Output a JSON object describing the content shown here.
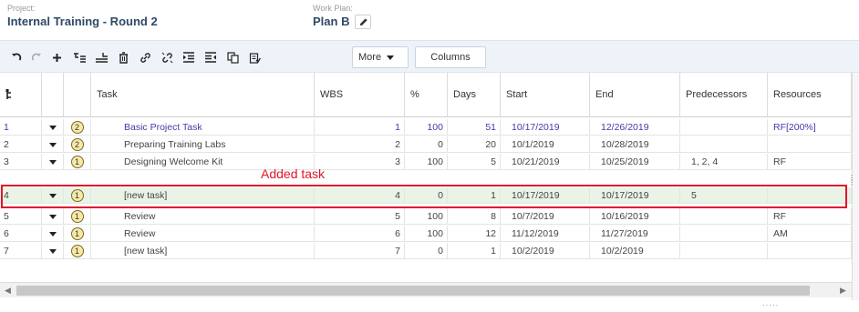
{
  "header": {
    "project_caption": "Project:",
    "project_name": "Internal Training - Round 2",
    "workplan_caption": "Work Plan:",
    "workplan_name": "Plan B"
  },
  "toolbar": {
    "more_label": "More",
    "columns_label": "Columns",
    "icons": [
      "undo-icon",
      "redo-icon",
      "add-icon",
      "indent-task-icon",
      "outdent-task-icon",
      "delete-icon",
      "link-icon",
      "unlink-icon",
      "indent-icon",
      "outdent-icon",
      "copy-icon",
      "paste-icon"
    ]
  },
  "columns": {
    "task": "Task",
    "wbs": "WBS",
    "pct": "%",
    "days": "Days",
    "start": "Start",
    "end": "End",
    "predecessors": "Predecessors",
    "resources": "Resources"
  },
  "rows": [
    {
      "num": "1",
      "level": "2",
      "task": "Basic Project Task",
      "wbs": "1",
      "pct": "100",
      "days": "51",
      "start": "10/17/2019",
      "end": "12/26/2019",
      "pred": "",
      "res": "RF[200%]"
    },
    {
      "num": "2",
      "level": "2",
      "task": "Preparing Training Labs",
      "wbs": "2",
      "pct": "0",
      "days": "20",
      "start": "10/1/2019",
      "end": "10/28/2019",
      "pred": "",
      "res": ""
    },
    {
      "num": "3",
      "level": "1",
      "task": "Designing Welcome Kit",
      "wbs": "3",
      "pct": "100",
      "days": "5",
      "start": "10/21/2019",
      "end": "10/25/2019",
      "pred": "1, 2, 4",
      "res": "RF"
    },
    {
      "num": "4",
      "level": "1",
      "task": "[new task]",
      "wbs": "4",
      "pct": "0",
      "days": "1",
      "start": "10/17/2019",
      "end": "10/17/2019",
      "pred": "5",
      "res": ""
    },
    {
      "num": "5",
      "level": "1",
      "task": "Review",
      "wbs": "5",
      "pct": "100",
      "days": "8",
      "start": "10/7/2019",
      "end": "10/16/2019",
      "pred": "",
      "res": "RF"
    },
    {
      "num": "6",
      "level": "1",
      "task": "Review",
      "wbs": "6",
      "pct": "100",
      "days": "12",
      "start": "11/12/2019",
      "end": "11/27/2019",
      "pred": "",
      "res": "AM"
    },
    {
      "num": "7",
      "level": "1",
      "task": "[new task]",
      "wbs": "7",
      "pct": "0",
      "days": "1",
      "start": "10/2/2019",
      "end": "10/2/2019",
      "pred": "",
      "res": ""
    }
  ],
  "annotation": "Added task",
  "colors": {
    "accent_purple": "#4b37a8",
    "highlight_red": "#e0162b",
    "selected_row": "#e9f4e7",
    "header_title": "#2e4a66"
  }
}
